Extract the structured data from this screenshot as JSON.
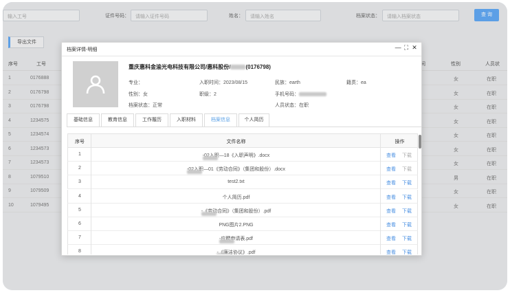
{
  "search": {
    "employee_placeholder": "输入工号",
    "id_label": "证件号码：",
    "id_placeholder": "请输入证件号码",
    "name_label": "姓名：",
    "name_placeholder": "请输入姓名",
    "status_label": "档案状态：",
    "status_placeholder": "请输入档案状态",
    "search_button": "查 询"
  },
  "toolbar": {
    "export_label": "导出文件"
  },
  "background_table": {
    "headers": {
      "no": "序号",
      "emp_no": "工号",
      "right1": "间",
      "gender": "性别",
      "status": "人员状"
    },
    "rows": [
      {
        "no": "1",
        "emp": "0176888",
        "gender": "女",
        "status": "在职"
      },
      {
        "no": "2",
        "emp": "0176798",
        "gender": "女",
        "status": "在职"
      },
      {
        "no": "3",
        "emp": "0176798",
        "gender": "女",
        "status": "在职"
      },
      {
        "no": "4",
        "emp": "1234575",
        "gender": "女",
        "status": "在职"
      },
      {
        "no": "5",
        "emp": "1234574",
        "gender": "女",
        "status": "在职"
      },
      {
        "no": "6",
        "emp": "1234573",
        "gender": "女",
        "status": "在职"
      },
      {
        "no": "7",
        "emp": "1234573",
        "gender": "女",
        "status": "在职"
      },
      {
        "no": "8",
        "emp": "1079510",
        "gender": "男",
        "status": "在职"
      },
      {
        "no": "9",
        "emp": "1079509",
        "gender": "女",
        "status": "在职"
      },
      {
        "no": "10",
        "emp": "1079495",
        "gender": "女",
        "status": "在职"
      }
    ]
  },
  "modal": {
    "title": "档案详情-明细",
    "controls": {
      "minimize": "—",
      "maximize": "⛶",
      "close": "✕"
    },
    "company": "重庆惠科金渝光电科技有限公司/惠科股份/",
    "company_suffix": "(0176798)",
    "fields": {
      "major_label": "专业：",
      "hire_label": "入职时间：",
      "hire_value": "2023/08/15",
      "ethnicity_label": "民族：",
      "ethnicity_value": "earth",
      "origin_label": "籍贯：",
      "origin_value": "ea",
      "gender_label": "性别：",
      "gender_value": "女",
      "rank_label": "职级：",
      "rank_value": "2",
      "phone_label": "手机号码：",
      "archive_label": "档案状态：",
      "archive_value": "正常",
      "person_label": "人员状态：",
      "person_value": "在职"
    },
    "tabs": [
      "基础信息",
      "教育信息",
      "工作履历",
      "入职材料",
      "档案信息",
      "个人简历"
    ],
    "active_tab": 4,
    "table": {
      "headers": {
        "no": "序号",
        "name": "文件名称",
        "ops": "操作"
      },
      "view_label": "查看",
      "download_label": "下载",
      "rows": [
        {
          "no": "1",
          "name": "-02入职—18《入职声明》.docx",
          "blur": true,
          "dl": false
        },
        {
          "no": "2",
          "name": "-02入职—01《劳动合同》（集团和股份）.docx",
          "blur": true,
          "dl": false
        },
        {
          "no": "3",
          "name": "test2.txt",
          "blur": false,
          "dl": true
        },
        {
          "no": "4",
          "name": "个人简历.pdf",
          "blur": false,
          "dl": true
        },
        {
          "no": "5",
          "name": "-《劳动合同》（集团和股份）.pdf",
          "blur": true,
          "dl": true
        },
        {
          "no": "6",
          "name": "PNG图片2.PNG",
          "blur": false,
          "dl": true
        },
        {
          "no": "7",
          "name": "-应聘申请表.pdf",
          "blur": true,
          "dl": true
        },
        {
          "no": "8",
          "name": "-《廉洁协议》.pdf",
          "blur": true,
          "dl": true
        }
      ]
    }
  }
}
